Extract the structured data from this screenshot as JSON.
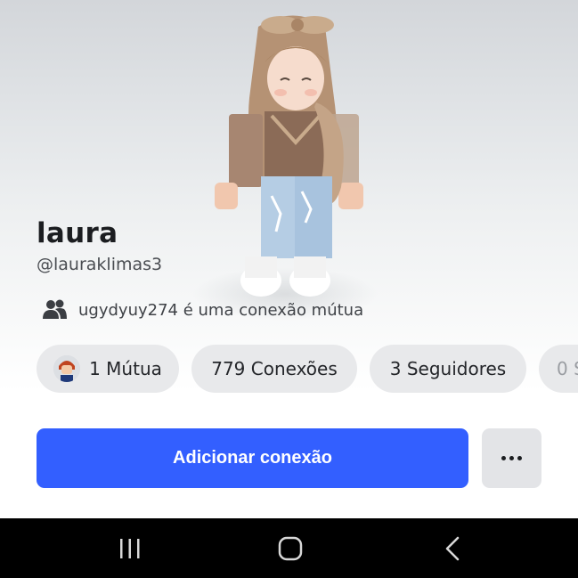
{
  "profile": {
    "display_name": "laura",
    "username": "@lauraklimas3",
    "mutual_connection_text": "ugydyuy274 é uma conexão mútua"
  },
  "stats": {
    "mutual_label": "1 Mútua",
    "connections_label": "779 Conexões",
    "followers_label": "3 Seguidores",
    "following_label": "0 S"
  },
  "actions": {
    "add_connection_label": "Adicionar conexão"
  },
  "icons": {
    "mutual": "people-icon",
    "more": "more-options-icon",
    "nav_recents": "recents-icon",
    "nav_home": "home-icon",
    "nav_back": "back-icon"
  },
  "colors": {
    "primary_button": "#335fff",
    "chip_background": "#e8e9eb",
    "navbar": "#000000"
  }
}
